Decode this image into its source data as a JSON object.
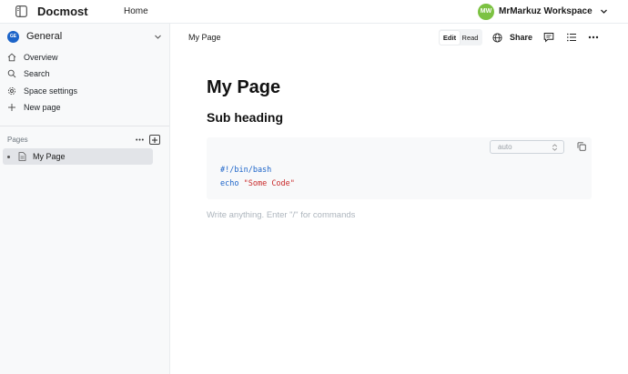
{
  "app": {
    "name": "Docmost",
    "home_label": "Home"
  },
  "workspace": {
    "initials": "MW",
    "name": "MrMarkuz Workspace",
    "avatar_color": "#7cc242"
  },
  "sidebar": {
    "space": {
      "initials": "GE",
      "name": "General",
      "avatar_color": "#1c64c9"
    },
    "nav": [
      {
        "label": "Overview",
        "icon": "home-icon"
      },
      {
        "label": "Search",
        "icon": "search-icon"
      },
      {
        "label": "Space settings",
        "icon": "gear-icon"
      },
      {
        "label": "New page",
        "icon": "plus-icon"
      }
    ],
    "pages_label": "Pages",
    "pages": [
      {
        "label": "My Page",
        "icon": "document-icon",
        "selected": true
      }
    ]
  },
  "header": {
    "breadcrumb": "My Page",
    "mode": {
      "edit": "Edit",
      "read": "Read",
      "active": "Edit"
    },
    "share_label": "Share"
  },
  "document": {
    "title": "My Page",
    "subheading": "Sub heading",
    "code_block": {
      "language": "auto",
      "line1": "#!/bin/bash",
      "line2_keyword": "echo",
      "line2_string": "\"Some Code\""
    },
    "placeholder": "Write anything. Enter \"/\" for commands"
  },
  "colors": {
    "accent": "#1c64c9",
    "string": "#c92a2a",
    "sidebar_bg": "#f8f9fa"
  }
}
